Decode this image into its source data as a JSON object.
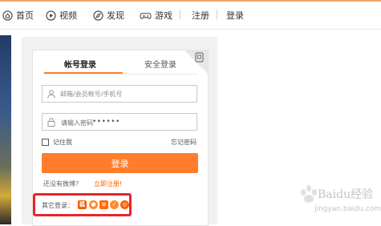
{
  "nav": {
    "items": [
      {
        "label": "首页",
        "icon": "home-icon"
      },
      {
        "label": "视频",
        "icon": "video-icon"
      },
      {
        "label": "发现",
        "icon": "compass-icon"
      },
      {
        "label": "游戏",
        "icon": "gamepad-icon"
      }
    ],
    "register": "注册",
    "login": "登录"
  },
  "login_panel": {
    "tabs": [
      {
        "label": "帐号登录",
        "active": true
      },
      {
        "label": "安全登录",
        "active": false
      }
    ],
    "corner_icon": "qr-switch-icon",
    "username": {
      "placeholder": "邮箱/会员帐号/手机号",
      "value": ""
    },
    "password": {
      "value_prefix": "请输入密码",
      "dots": "••••••"
    },
    "remember_label": "记住我",
    "remember_checked": false,
    "forgot_label": "忘记密码",
    "submit_label": "登录",
    "no_weibo_text": "还没有微博？",
    "register_link": "立即注册!",
    "other_login_label": "其它登录：",
    "other_login_icons": [
      {
        "name": "sohu-icon",
        "glyph": "狐",
        "color": "#ff5a00"
      },
      {
        "name": "qq-icon",
        "glyph": "●",
        "color": "#ff8a2a"
      },
      {
        "name": "stack-icon",
        "glyph": "≡",
        "color": "#ff6a10"
      },
      {
        "name": "weibo-icon",
        "glyph": "✓",
        "color": "#ff8a2a"
      },
      {
        "name": "renren-icon",
        "glyph": "◎",
        "color": "#ff5a00"
      }
    ]
  },
  "watermark": {
    "line1": "Baidu经验",
    "line2": "jingyan.baidu.com"
  },
  "colors": {
    "accent": "#ff7d2c",
    "highlight": "#e8262a",
    "link": "#ff5a00"
  }
}
